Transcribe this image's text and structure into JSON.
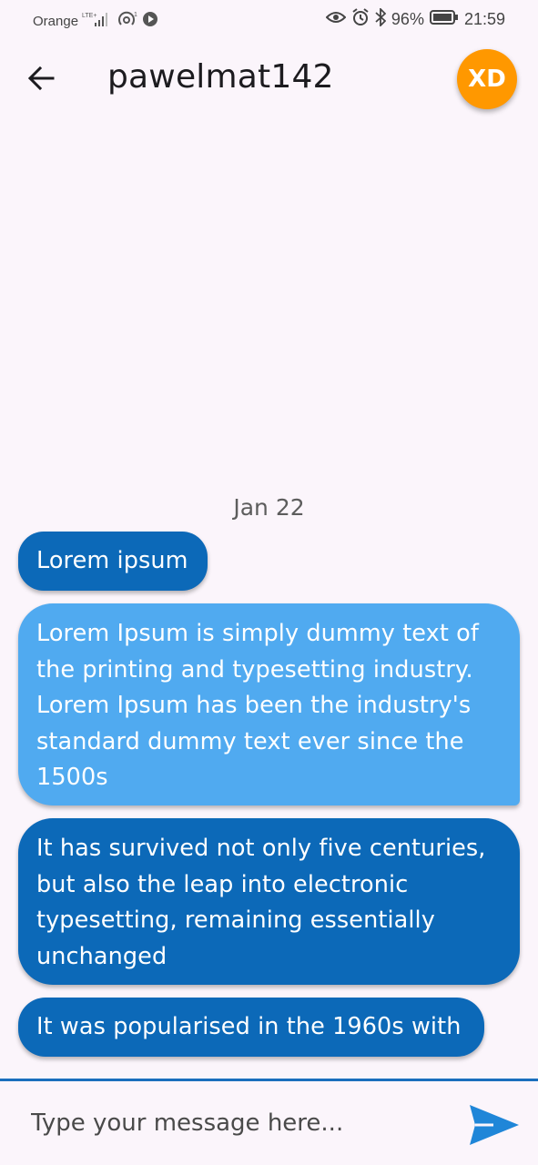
{
  "status_bar": {
    "carrier": "Orange",
    "network": "LTE+",
    "battery": "96%",
    "time": "21:59"
  },
  "header": {
    "title": "pawelmat142",
    "avatar_initials": "XD",
    "avatar_color": "#ff9800"
  },
  "chat": {
    "date_separator": "Jan 22",
    "messages": [
      {
        "text": "Lorem ipsum",
        "style": "dark"
      },
      {
        "text": "Lorem Ipsum is simply dummy text of the printing and typesetting industry. Lorem Ipsum has been the industry's standard dummy text ever since the 1500s",
        "style": "light"
      },
      {
        "text": "It has survived not only five centuries, but also the leap into electronic typesetting, remaining essentially unchanged",
        "style": "dark"
      },
      {
        "text": "It was popularised in the 1960s with",
        "style": "dark"
      }
    ]
  },
  "composer": {
    "placeholder": "Type your message here...",
    "value": ""
  },
  "colors": {
    "bubble_dark": "#0c69b8",
    "bubble_light": "#50aaf0",
    "accent": "#1a6fbd",
    "background": "#fbf5fb"
  }
}
